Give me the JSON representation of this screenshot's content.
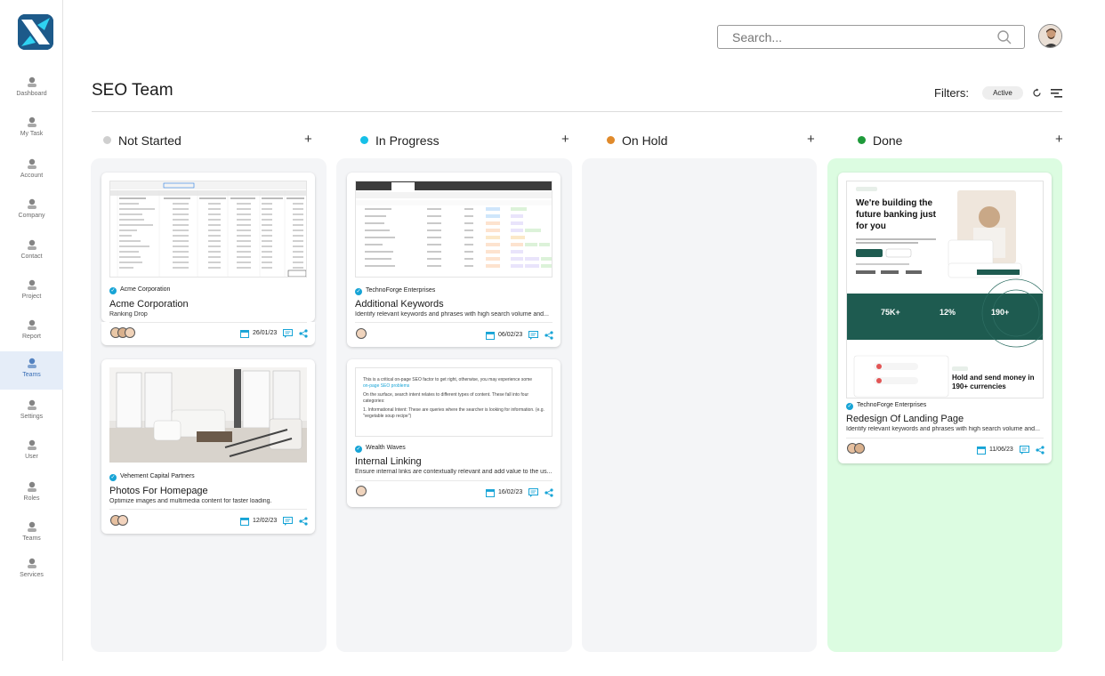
{
  "nav": [
    {
      "label": "Dashboard",
      "icon": "gauge-icon"
    },
    {
      "label": "My Task",
      "icon": "task-icon"
    },
    {
      "label": "Account",
      "icon": "account-icon"
    },
    {
      "label": "Company",
      "icon": "company-icon"
    },
    {
      "label": "Contact",
      "icon": "contact-icon"
    },
    {
      "label": "Project",
      "icon": "project-icon"
    },
    {
      "label": "Report",
      "icon": "report-icon"
    },
    {
      "label": "Teams",
      "icon": "teams-icon",
      "active": true
    },
    {
      "label": "Settings",
      "icon": "gear-icon"
    },
    {
      "label": "User",
      "icon": "user-icon"
    },
    {
      "label": "Roles",
      "icon": "roles-icon"
    },
    {
      "label": "Teams",
      "icon": "teams-alt-icon"
    },
    {
      "label": "Services",
      "icon": "services-icon"
    }
  ],
  "search": {
    "placeholder": "Search..."
  },
  "page": {
    "title": "SEO Team"
  },
  "filters": {
    "label": "Filters:",
    "active_chip": "Active"
  },
  "colors": {
    "accent": "#17a4d6",
    "done_bg": "#dcfce1",
    "not_started": "#cfcfcf",
    "in_progress": "#16c0e8",
    "on_hold": "#e08a2b",
    "done": "#1f9a3a"
  },
  "columns": [
    {
      "name": "Not Started",
      "cards": [
        {
          "org": "Acme Corporation",
          "title": "Acme Corporation",
          "desc": "Ranking Drop",
          "date": "26/01/23"
        },
        {
          "org": "Vehement Capital Partners",
          "title": "Photos For Homepage",
          "desc": "Optimize images and multimedia content for faster loading.",
          "date": "12/02/23"
        }
      ]
    },
    {
      "name": "In Progress",
      "cards": [
        {
          "org": "TechnoForge Enterprises",
          "title": "Additional Keywords",
          "desc": "Identify relevant keywords and phrases with high search volume and...",
          "date": "06/02/23"
        },
        {
          "org": "Wealth Waves",
          "title": "Internal Linking",
          "desc": "Ensure internal links are contextually relevant and add value to the us...",
          "date": "16/02/23"
        }
      ]
    },
    {
      "name": "On Hold",
      "cards": []
    },
    {
      "name": "Done",
      "cards": [
        {
          "org": "TechnoForge Enterprises",
          "title": "Redesign Of Landing Page",
          "desc": "Identify relevant keywords and phrases with high search volume and...",
          "date": "11/06/23"
        }
      ]
    }
  ],
  "thumb_texts": {
    "landing_headline": "We're building the future banking just for you",
    "landing_stat1": "75K+",
    "landing_stat2": "12%",
    "landing_stat3": "190+",
    "landing_bottom": "Hold and send money in 190+ currencies",
    "article_line1": "This is a critical on-page SEO factor to get right, otherwise, you may experience some",
    "article_link": "on-page SEO problems",
    "article_line2": "On the surface, search intent relates to different types of content. These fall into four categories:",
    "article_line3": "1. Informational Intent: These are queries where the searcher is looking for information. (e.g. \"vegetable soup recipe\")"
  }
}
